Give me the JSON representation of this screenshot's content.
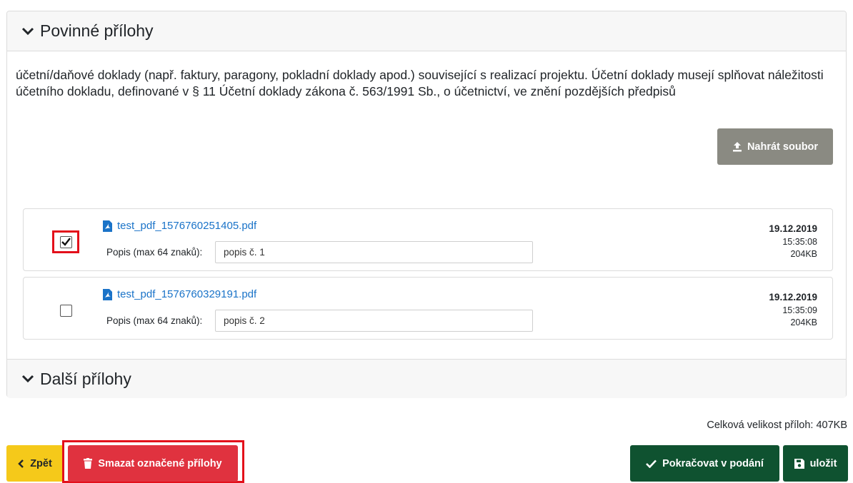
{
  "sections": {
    "required": {
      "title": "Povinné přílohy"
    },
    "other": {
      "title": "Další přílohy"
    }
  },
  "description": "účetní/daňové doklady (např. faktury, paragony, pokladní doklady apod.) související s realizací projektu. Účetní doklady musejí splňovat náležitosti účetního dokladu, definované v § 11 Účetní doklady zákona č. 563/1991 Sb., o účetnictví, ve znění pozdějších předpisů",
  "upload_button": {
    "label": "Nahrát soubor",
    "icon": "upload-icon"
  },
  "files": [
    {
      "name": "test_pdf_1576760251405.pdf",
      "checked": true,
      "popis_label": "Popis (max 64 znaků):",
      "popis_value": "popis č. 1",
      "date": "19.12.2019",
      "time": "15:35:08",
      "size": "204KB"
    },
    {
      "name": "test_pdf_1576760329191.pdf",
      "checked": false,
      "popis_label": "Popis (max 64 znaků):",
      "popis_value": "popis č. 2",
      "date": "19.12.2019",
      "time": "15:35:09",
      "size": "204KB"
    }
  ],
  "total_size": "Celková velikost příloh: 407KB",
  "buttons": {
    "back": "Zpět",
    "delete": "Smazat označené přílohy",
    "continue": "Pokračovat v podání",
    "save": "uložit"
  },
  "colors": {
    "upload": "#8a8a82",
    "back": "#f5c91a",
    "delete": "#e0323f",
    "primary": "#0f5230",
    "link": "#1a73c8",
    "highlight": "#e3101b"
  }
}
